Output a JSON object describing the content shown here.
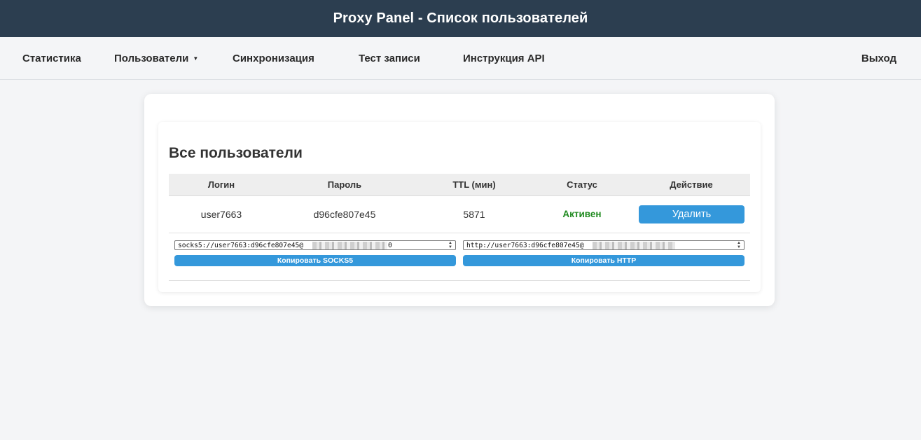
{
  "header": {
    "title": "Proxy Panel - Список пользователей"
  },
  "nav": {
    "stats": "Статистика",
    "users": "Пользователи",
    "sync": "Синхронизация",
    "test": "Тест записи",
    "api": "Инструкция API",
    "exit": "Выход"
  },
  "section": {
    "title": "Все пользователи"
  },
  "table": {
    "headers": [
      "Логин",
      "Пароль",
      "TTL (мин)",
      "Статус",
      "Действие"
    ],
    "rows": [
      {
        "login": "user7663",
        "password": "d96cfe807e45",
        "ttl": "5871",
        "status": "Активен",
        "action": "Удалить",
        "socks5": "socks5://user7663:d96cfe807e45@",
        "socks5_tail": "0",
        "http": "http://user7663:d96cfe807e45@",
        "copy_socks5": "Копировать SOCKS5",
        "copy_http": "Копировать HTTP"
      }
    ]
  },
  "colors": {
    "header_bg": "#2c3e50",
    "accent": "#3498db",
    "status_active": "#1f8a1f"
  }
}
